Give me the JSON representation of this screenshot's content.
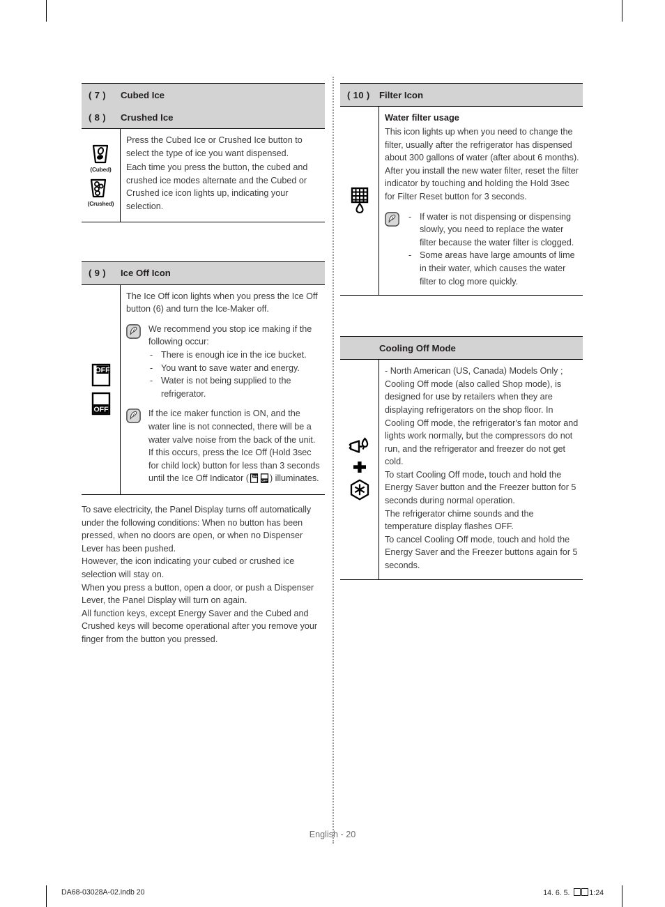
{
  "footer": {
    "page_label": "English - 20",
    "file_stamp": "DA68-03028A-02.indb   20",
    "date_stamp_date": "14. 6. 5.",
    "date_stamp_time": "1:24"
  },
  "left_column": {
    "ice_type_section": {
      "headers": [
        {
          "num": "( 7 )",
          "title": "Cubed Ice"
        },
        {
          "num": "( 8 )",
          "title": "Crushed Ice"
        }
      ],
      "icons": [
        {
          "name": "cubed-ice-icon",
          "caption": "(Cubed)"
        },
        {
          "name": "crushed-ice-icon",
          "caption": "(Crushed)"
        }
      ],
      "paragraphs": [
        "Press the Cubed Ice or Crushed Ice button to select the type of ice you want dispensed.",
        "Each time you press the button, the cubed and crushed ice modes alternate and the Cubed or Crushed ice icon lights up, indicating your selection."
      ]
    },
    "ice_off_section": {
      "header": {
        "num": "( 9 )",
        "title": "Ice Off Icon"
      },
      "icons": [
        {
          "name": "ice-off-indicator-top-icon",
          "label": "OFF"
        },
        {
          "name": "ice-off-indicator-bottom-icon",
          "label": "OFF"
        }
      ],
      "intro": "The Ice Off icon lights when you press the Ice Off button (6) and turn the Ice-Maker off.",
      "note_1": {
        "lead": "We recommend you stop ice making if the following occur:",
        "items": [
          "There is enough ice in the ice bucket.",
          "You want to save water and energy.",
          "Water is not being supplied to the refrigerator."
        ]
      },
      "note_2": {
        "text_before_icons": "If the ice maker function is ON, and the water line is not connected, there will be a water valve noise from the back of the unit. If this occurs, press the Ice Off (Hold 3sec for child lock) button for less than 3 seconds until the Ice Off Indicator (",
        "text_after_icons": ") illuminates."
      }
    },
    "panel_display_text": [
      "To save electricity, the Panel Display turns off automatically under the following conditions: When no button has been pressed, when no doors are open, or when no Dispenser Lever has been pushed.",
      "However, the icon indicating your cubed or crushed ice selection will stay on.",
      "When you press a button, open a door, or push a Dispenser Lever, the Panel Display will turn on again.",
      "All function keys, except Energy Saver and the Cubed and Crushed keys will become operational after you remove your finger from the button you pressed."
    ]
  },
  "right_column": {
    "filter_section": {
      "header": {
        "num": "( 10 )",
        "title": "Filter Icon"
      },
      "icon_name": "water-filter-icon",
      "subtitle": "Water filter usage",
      "paragraph": "This icon lights up when you need to change the filter, usually after the refrigerator has dispensed about 300 gallons of water (after about 6 months). After you install the new water filter, reset the filter indicator by touching and holding the Hold 3sec for Filter Reset button for 3 seconds.",
      "note_items": [
        "If water is not dispensing or dispensing slowly, you need to replace the water filter because the water filter is clogged.",
        "Some areas have large amounts of lime in their water, which causes the water filter to clog more quickly."
      ]
    },
    "cooling_off_section": {
      "header": {
        "title": "Cooling Off Mode"
      },
      "icons": [
        {
          "name": "energy-saver-icon"
        },
        {
          "name": "plus-icon"
        },
        {
          "name": "freezer-snowflake-icon"
        }
      ],
      "paragraphs": [
        "-   North American (US, Canada) Models Only ; Cooling Off mode (also called Shop mode), is designed for use by retailers when they are displaying refrigerators on the shop floor. In Cooling Off mode, the refrigerator's fan motor and lights work normally, but the compressors do not run, and the refrigerator and freezer do not get cold.",
        "To start Cooling Off mode, touch and hold the Energy Saver button and the Freezer button for 5 seconds during normal operation.",
        "The refrigerator chime sounds and the temperature display flashes OFF.",
        "To cancel Cooling Off mode, touch and hold the Energy Saver and the Freezer buttons again for 5 seconds."
      ]
    }
  },
  "colors": {
    "header_band": "#d3d3d3",
    "rule": "#000000",
    "body_text": "#3a3a3a",
    "page_label": "#6e6e6e"
  }
}
